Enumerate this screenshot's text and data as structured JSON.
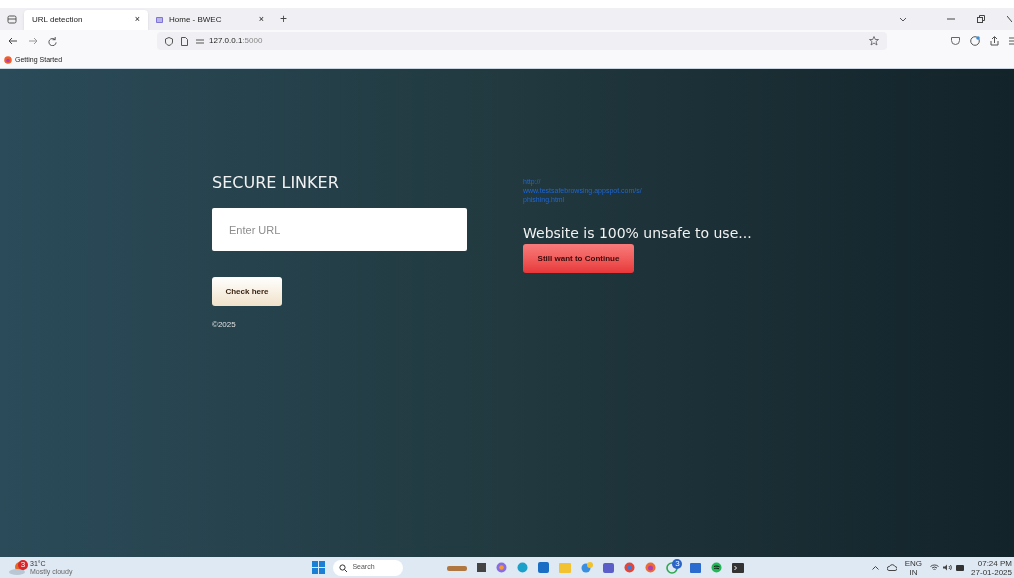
{
  "browser": {
    "tabs": [
      {
        "label": "URL detection",
        "selected": true,
        "close": "×"
      },
      {
        "label": "Home - BWEC",
        "selected": false,
        "close": "×"
      }
    ],
    "new_tab": "+",
    "address": {
      "host": "127.0.0.1",
      "port": ":5000"
    },
    "bookmarks": [
      {
        "label": "Getting Started"
      }
    ]
  },
  "page": {
    "title": "SECURE LINKER",
    "url_field": {
      "placeholder": "Enter URL"
    },
    "check_button": "Check here",
    "footer": "©2025",
    "checked_url": "http://\nwww.testsafebrowsing.appspot.com/s/\nphishing.html",
    "verdict": "Website is 100% unsafe to use...",
    "continue_button": "Still want to Continue"
  },
  "taskbar": {
    "weather": {
      "badge": "3",
      "temp": "31°C",
      "text": "Mostly cloudy"
    },
    "search": "Search",
    "whatsapp_badge": "3",
    "lang": "ENG",
    "region": "IN",
    "time": "07:24 PM",
    "date": "27-01-2025"
  }
}
